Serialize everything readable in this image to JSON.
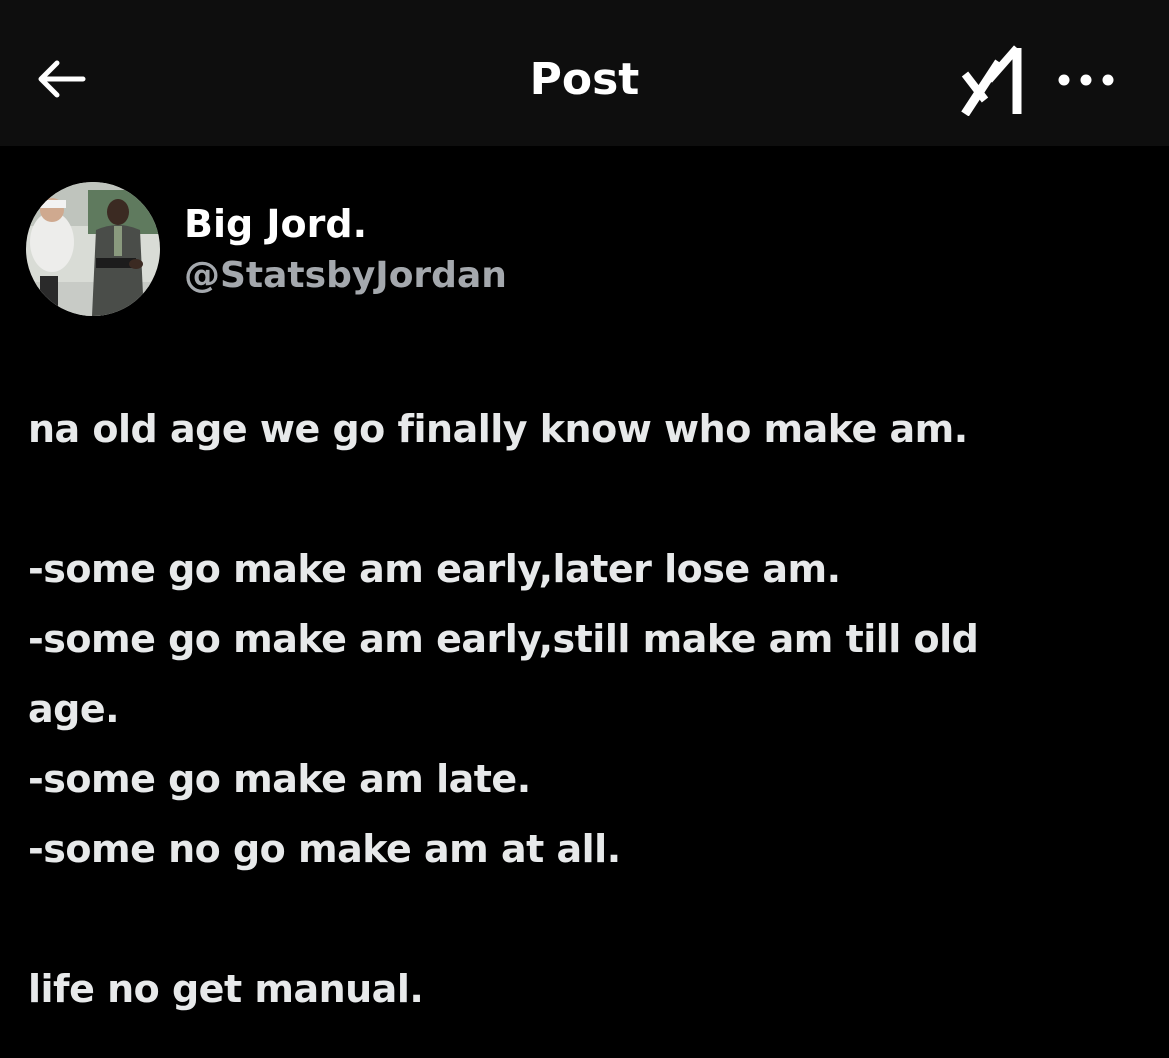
{
  "header": {
    "title": "Post",
    "back_icon": "arrow-left-icon",
    "grok_icon": "grok-logo-icon",
    "more_icon": "more-horizontal-icon"
  },
  "author": {
    "name": "Big Jord.",
    "handle": "@StatsbyJordan"
  },
  "post": {
    "lines": [
      "na old age we go finally know who make am.",
      "",
      "-some go make am early,later lose am.",
      "-some go make am early,still make am till old",
      "age.",
      "-some go make am late.",
      "-some no go make am at all.",
      "",
      "life no get manual."
    ]
  },
  "colors": {
    "background": "#000000",
    "header_background": "#0e0e0e",
    "text_primary": "#e7e9ea",
    "text_secondary": "#a4a8ad"
  }
}
